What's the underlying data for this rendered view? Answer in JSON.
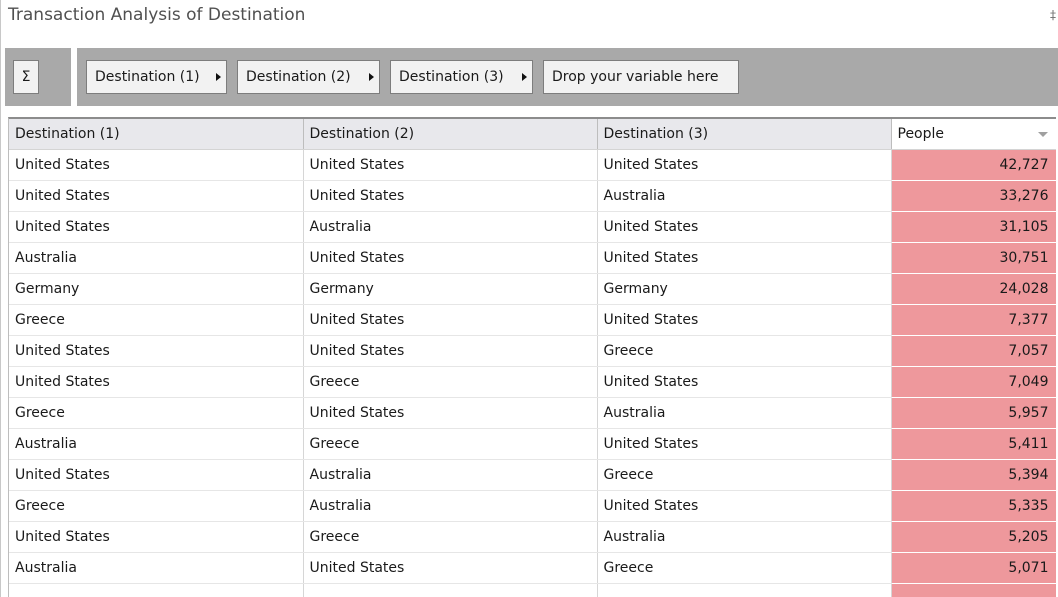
{
  "window": {
    "title": "Transaction Analysis of Destination",
    "pin_glyph": "‡"
  },
  "toolbar": {
    "sigma_label": "Σ",
    "variables": [
      {
        "label": "Destination (1)"
      },
      {
        "label": "Destination (2)"
      },
      {
        "label": "Destination (3)"
      }
    ],
    "drop_label": "Drop your variable here"
  },
  "table": {
    "columns": [
      "Destination (1)",
      "Destination (2)",
      "Destination (3)",
      "People"
    ],
    "rows": [
      {
        "d1": "United States",
        "d2": "United States",
        "d3": "United States",
        "people": "42,727"
      },
      {
        "d1": "United States",
        "d2": "United States",
        "d3": "Australia",
        "people": "33,276"
      },
      {
        "d1": "United States",
        "d2": "Australia",
        "d3": "United States",
        "people": "31,105"
      },
      {
        "d1": "Australia",
        "d2": "United States",
        "d3": "United States",
        "people": "30,751"
      },
      {
        "d1": "Germany",
        "d2": "Germany",
        "d3": "Germany",
        "people": "24,028"
      },
      {
        "d1": "Greece",
        "d2": "United States",
        "d3": "United States",
        "people": "7,377"
      },
      {
        "d1": "United States",
        "d2": "United States",
        "d3": "Greece",
        "people": "7,057"
      },
      {
        "d1": "United States",
        "d2": "Greece",
        "d3": "United States",
        "people": "7,049"
      },
      {
        "d1": "Greece",
        "d2": "United States",
        "d3": "Australia",
        "people": "5,957"
      },
      {
        "d1": "Australia",
        "d2": "Greece",
        "d3": "United States",
        "people": "5,411"
      },
      {
        "d1": "United States",
        "d2": "Australia",
        "d3": "Greece",
        "people": "5,394"
      },
      {
        "d1": "Greece",
        "d2": "Australia",
        "d3": "United States",
        "people": "5,335"
      },
      {
        "d1": "United States",
        "d2": "Greece",
        "d3": "Australia",
        "people": "5,205"
      },
      {
        "d1": "Australia",
        "d2": "United States",
        "d3": "Greece",
        "people": "5,071"
      },
      {
        "d1": "",
        "d2": "",
        "d3": "",
        "people": ""
      }
    ]
  },
  "colors": {
    "heat_cell": "#ee989c",
    "toolbar_bg": "#a9a9a9",
    "header_bg": "#e8e8ec"
  }
}
